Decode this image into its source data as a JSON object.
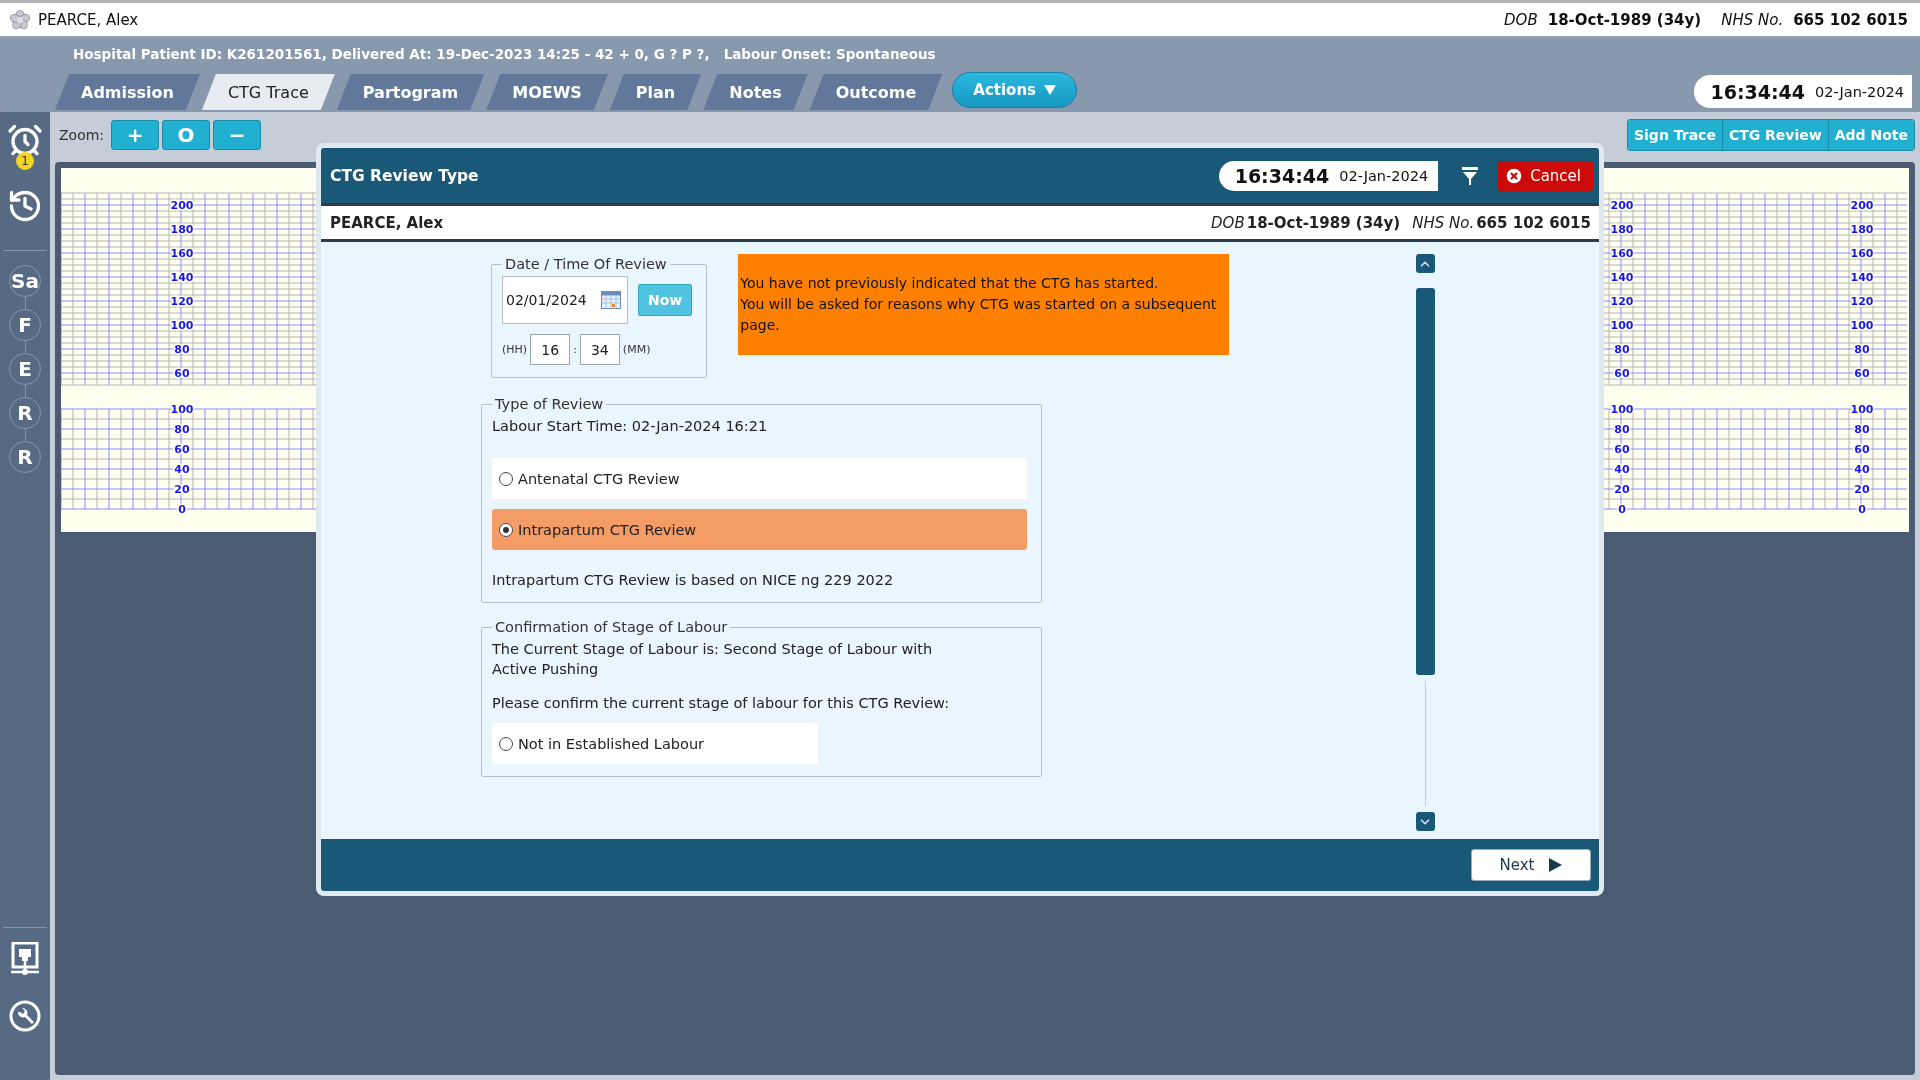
{
  "header": {
    "patient_name": "PEARCE, Alex",
    "dob_label": "DOB",
    "dob": "18-Oct-1989 (34y)",
    "nhs_label": "NHS No.",
    "nhs": "665 102 6015"
  },
  "info_line": "Hospital Patient ID: K261201561, Delivered At: 19-Dec-2023 14:25 - 42 + 0, G ? P ?,   Labour Onset: Spontaneous",
  "tabs": [
    {
      "label": "Admission",
      "selected": false
    },
    {
      "label": "CTG Trace",
      "selected": true
    },
    {
      "label": "Partogram",
      "selected": false
    },
    {
      "label": "MOEWS",
      "selected": false
    },
    {
      "label": "Plan",
      "selected": false
    },
    {
      "label": "Notes",
      "selected": false
    },
    {
      "label": "Outcome",
      "selected": false
    }
  ],
  "actions_label": "Actions",
  "clock": {
    "time": "16:34:44",
    "date": "02-Jan-2024"
  },
  "sidebar": {
    "alarm_count": "1",
    "stages": [
      "Sa",
      "F",
      "E",
      "R",
      "R"
    ]
  },
  "zoom": {
    "label": "Zoom:",
    "buttons": [
      "+",
      "O",
      "−"
    ]
  },
  "trace_buttons": [
    "Sign Trace",
    "CTG Review",
    "Add Note"
  ],
  "trace_scales": [
    {
      "fhr_ticks": [
        "200",
        "180",
        "160",
        "140",
        "120",
        "100",
        "80",
        "60"
      ],
      "toco_ticks": [
        "100",
        "80",
        "60",
        "40",
        "20",
        "0"
      ]
    },
    {
      "fhr_ticks": [
        "200",
        "180",
        "160",
        "140",
        "120",
        "100",
        "80",
        "60"
      ],
      "toco_ticks": [
        "100",
        "80",
        "60",
        "40",
        "20",
        "0"
      ]
    },
    {
      "fhr_ticks": [
        "200",
        "180",
        "160",
        "140",
        "120",
        "100",
        "80",
        "60"
      ],
      "toco_ticks": [
        "100",
        "80",
        "60",
        "40",
        "20",
        "0"
      ]
    }
  ],
  "dialog": {
    "title": "CTG Review Type",
    "clock": {
      "time": "16:34:44",
      "date": "02-Jan-2024"
    },
    "cancel_label": "Cancel",
    "patient": {
      "patient_name": "PEARCE, Alex",
      "dob_label": "DOB",
      "dob": "18-Oct-1989 (34y)",
      "nhs_label": "NHS No.",
      "nhs": "665 102 6015"
    },
    "review_time": {
      "legend": "Date / Time Of Review",
      "date": "02/01/2024",
      "now_label": "Now",
      "hh_label": "(HH)",
      "hours": "16",
      "separator": ":",
      "minutes": "34",
      "mm_label": "(MM)"
    },
    "warning": [
      "You have not previously indicated that the CTG has started.",
      "You will be asked for reasons why CTG was started on a subsequent page."
    ],
    "review_type": {
      "legend": "Type of Review",
      "labour_start": "Labour Start Time: 02-Jan-2024 16:21",
      "options": [
        {
          "label": "Antenatal CTG Review",
          "selected": false
        },
        {
          "label": "Intrapartum CTG Review",
          "selected": true
        }
      ],
      "note": "Intrapartum CTG Review is based on NICE ng 229 2022"
    },
    "stage": {
      "legend": "Confirmation of Stage of Labour",
      "current": "The Current Stage of Labour is: Second Stage of Labour with Active Pushing",
      "prompt": "Please confirm the current stage of labour for this CTG Review:",
      "options": [
        {
          "label": "Not in Established Labour",
          "selected": false
        }
      ]
    },
    "next_label": "Next"
  }
}
